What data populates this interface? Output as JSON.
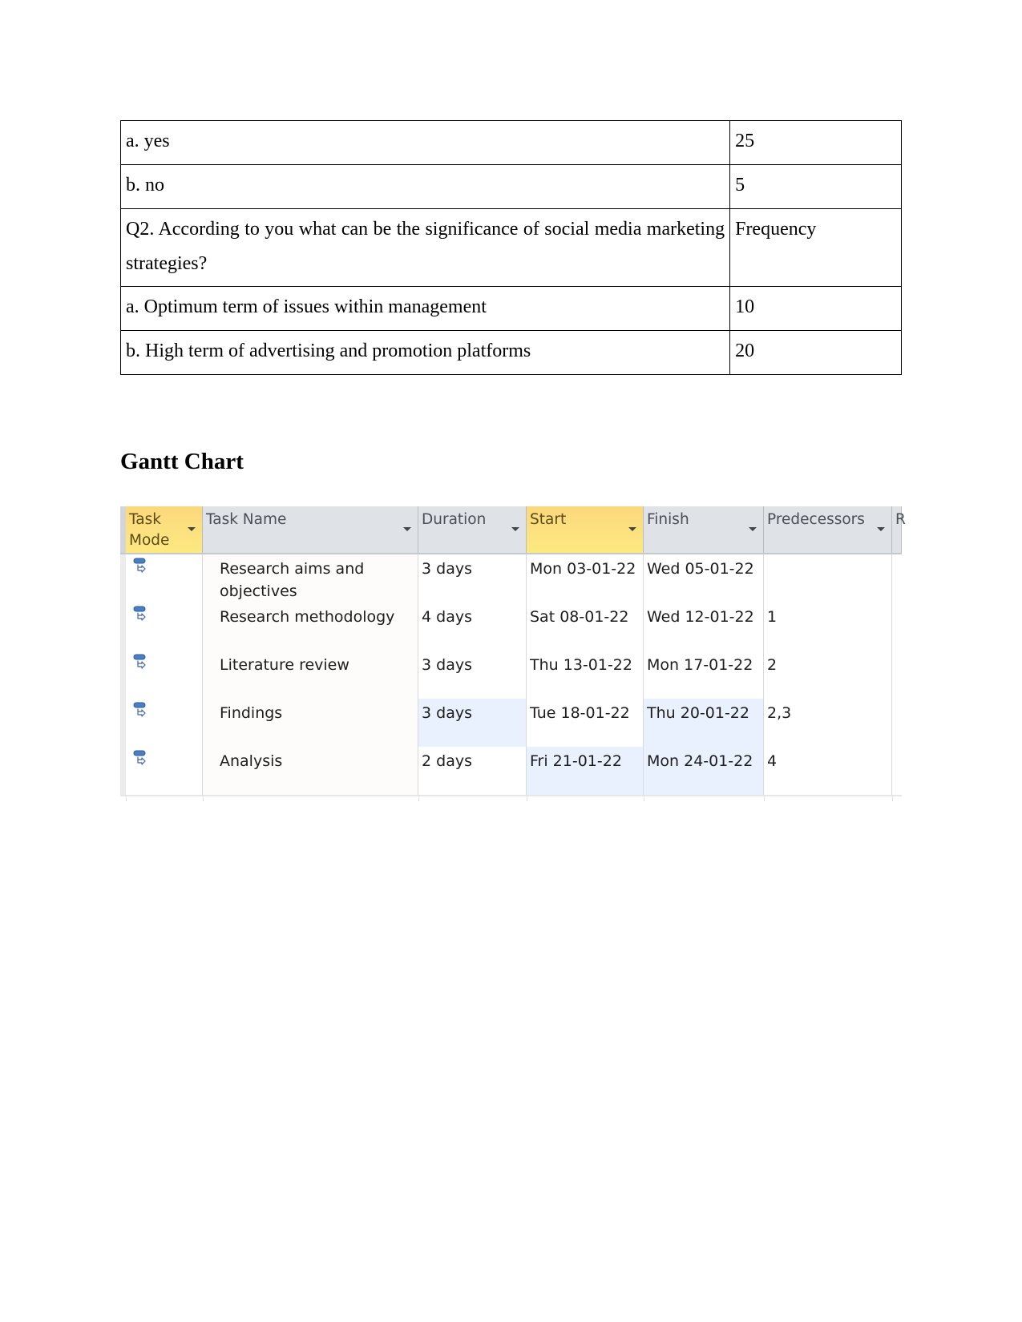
{
  "survey_table": {
    "rows": [
      {
        "label": "a. yes",
        "value": "25"
      },
      {
        "label": "b. no",
        "value": "5"
      },
      {
        "label": "Q2. According to you what can be the significance of social media marketing strategies?",
        "value": "Frequency"
      },
      {
        "label": "a. Optimum term of issues within management",
        "value": "10"
      },
      {
        "label": "b. High term of advertising and promotion platforms",
        "value": "20"
      }
    ]
  },
  "gantt": {
    "title": "Gantt Chart",
    "columns": [
      {
        "label": "Task Mode",
        "active": true
      },
      {
        "label": "Task Name",
        "active": false
      },
      {
        "label": "Duration",
        "active": false
      },
      {
        "label": "Start",
        "active": true
      },
      {
        "label": "Finish",
        "active": false
      },
      {
        "label": "Predecessors",
        "active": false
      },
      {
        "label": "R",
        "active": false
      }
    ],
    "task_mode_icon": "auto-scheduled-task-icon",
    "tasks": [
      {
        "name": "Research aims and objectives",
        "duration": "3 days",
        "start": "Mon 03-01-22",
        "finish": "Wed 05-01-22",
        "predecessors": ""
      },
      {
        "name": "Research methodology",
        "duration": "4 days",
        "start": "Sat 08-01-22",
        "finish": "Wed 12-01-22",
        "predecessors": "1"
      },
      {
        "name": "Literature review",
        "duration": "3 days",
        "start": "Thu 13-01-22",
        "finish": "Mon 17-01-22",
        "predecessors": "2"
      },
      {
        "name": "Findings",
        "duration": "3 days",
        "start": "Tue 18-01-22",
        "finish": "Thu 20-01-22",
        "predecessors": "2,3"
      },
      {
        "name": "Analysis",
        "duration": "2 days",
        "start": "Fri 21-01-22",
        "finish": "Mon 24-01-22",
        "predecessors": "4"
      }
    ],
    "colors": {
      "header_bg": "#dfe3e8",
      "active_header": "#fcd87c",
      "highlight_cell": "#e8f1fd"
    }
  }
}
